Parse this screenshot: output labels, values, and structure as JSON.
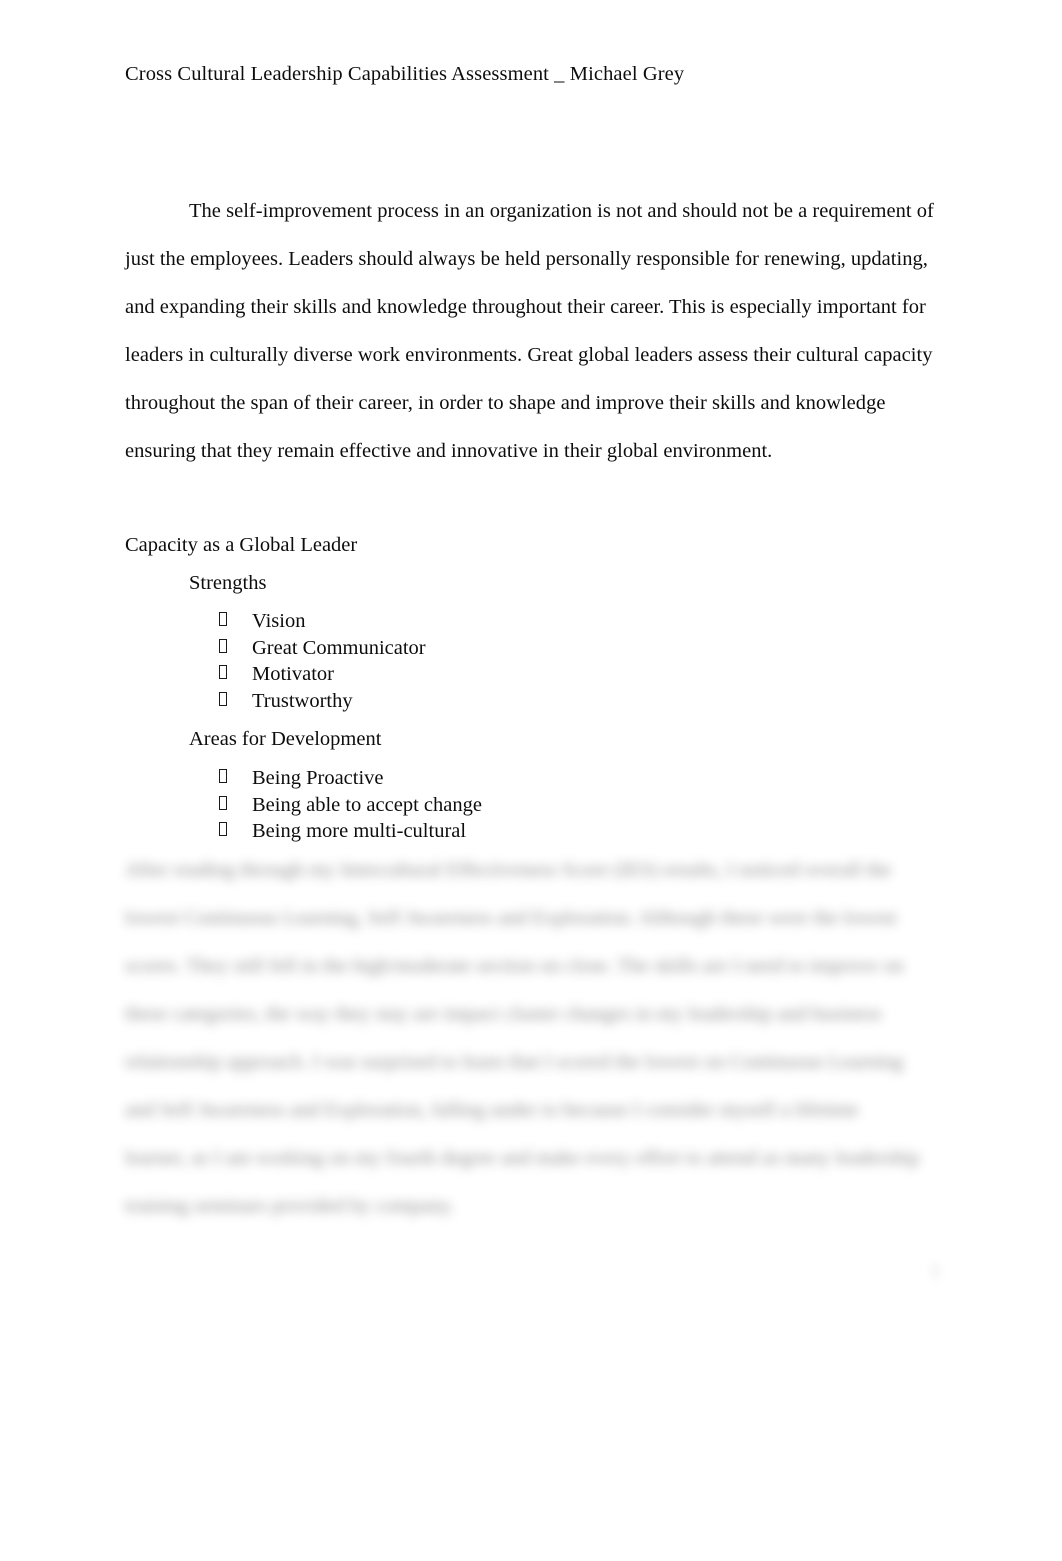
{
  "document": {
    "running_header": "Cross Cultural Leadership Capabilities Assessment _ Michael Grey",
    "page_number": "1"
  },
  "intro_paragraph": {
    "text": "The self-improvement process in an organization is not and should not be a requirement of just the employees. Leaders should always be held personally responsible for renewing, updating, and expanding their skills and knowledge throughout their career. This is especially important for leaders in culturally diverse work environments. Great global leaders assess their cultural capacity throughout the span of their career, in order to shape and improve their skills and knowledge ensuring that they remain effective and innovative in their global environment."
  },
  "sections": {
    "capacity_heading": "Capacity as a Global Leader",
    "strengths": {
      "heading": "Strengths",
      "bullet_marker": "missing-glyph-box",
      "items": [
        "Vision",
        "Great Communicator",
        "Motivator",
        "Trustworthy"
      ]
    },
    "areas_for_development": {
      "heading": "Areas for Development",
      "bullet_marker": "missing-glyph-box",
      "items": [
        "Being Proactive",
        "Being able to accept change",
        "Being more multi-cultural"
      ]
    }
  },
  "redacted_paragraph": {
    "state": "blurred-illegible",
    "line_count": 8,
    "placeholder_lines": [
      "After reading through my Intercultural Effectiveness Score (IES) results, I noticed overall the",
      "lowest Continuous Learning, Self Awareness and Exploration. Although these were the lowest",
      "scores. They still fell in the high/moderate section on close. The skills are I need to improve on",
      "these categories, the way they stay are impact cluster changes in my leadership and business",
      "relationship approach. I was surprised to learn that I scored the lowest on Continuous Learning",
      "and Self Awareness and Exploration, falling under to because I consider myself a lifetime",
      "learner, as I am working on my fourth degree and make every effort to attend as many leadership",
      "training seminars provided by company."
    ]
  },
  "colors": {
    "page_background": "#ffffff",
    "body_text": "#0d0d0d",
    "redacted_text": "#4a4a4a"
  }
}
